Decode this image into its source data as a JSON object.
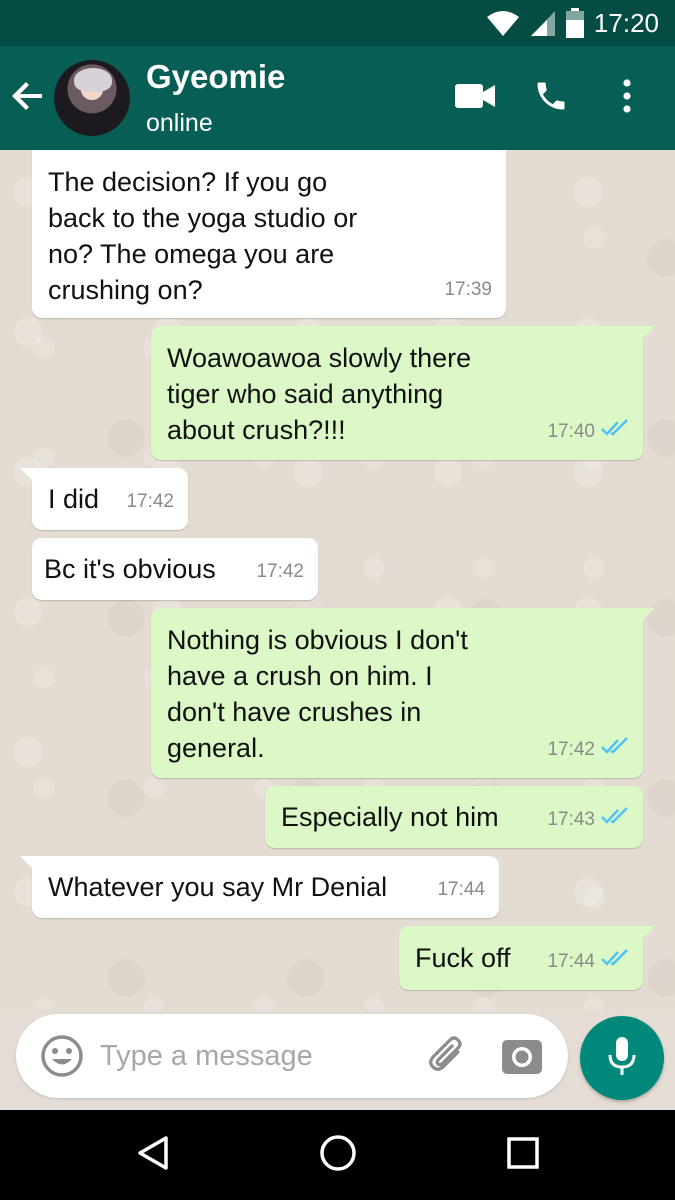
{
  "status_bar": {
    "time": "17:20"
  },
  "contact": {
    "name": "Gyeomie",
    "status": "online"
  },
  "messages": [
    {
      "dir": "in",
      "text": "The decision? If you go\nback to the yoga studio or\nno? The omega you are\ncrushing on?",
      "time": "17:39"
    },
    {
      "dir": "out",
      "text": "Woawoawoa slowly there\ntiger who said anything\nabout crush?!!!",
      "time": "17:40",
      "read": true
    },
    {
      "dir": "in",
      "text": "I did",
      "time": "17:42"
    },
    {
      "dir": "in",
      "text": "Bc it's obvious",
      "time": "17:42"
    },
    {
      "dir": "out",
      "text": "Nothing is obvious I don't\nhave a crush on him. I\ndon't have crushes in\ngeneral.",
      "time": "17:42",
      "read": true
    },
    {
      "dir": "out",
      "text": "Especially not him",
      "time": "17:43",
      "read": true
    },
    {
      "dir": "in",
      "text": "Whatever you say Mr Denial",
      "time": "17:44"
    },
    {
      "dir": "out",
      "text": "Fuck off",
      "time": "17:44",
      "read": true
    }
  ],
  "input": {
    "placeholder": "Type a message"
  },
  "colors": {
    "header": "#075e54",
    "status_bar": "#054d44",
    "outgoing_bubble": "#dcf8c6",
    "incoming_bubble": "#ffffff",
    "read_ticks": "#4fc3f7",
    "mic_button": "#00897b"
  },
  "icons": {
    "status": [
      "wifi-icon",
      "signal-icon",
      "battery-icon"
    ],
    "header": [
      "back-arrow-icon",
      "video-call-icon",
      "phone-icon",
      "more-vert-icon"
    ],
    "input": [
      "emoji-icon",
      "attach-icon",
      "camera-icon",
      "mic-icon"
    ],
    "nav": [
      "nav-back-icon",
      "nav-home-icon",
      "nav-recents-icon"
    ]
  }
}
